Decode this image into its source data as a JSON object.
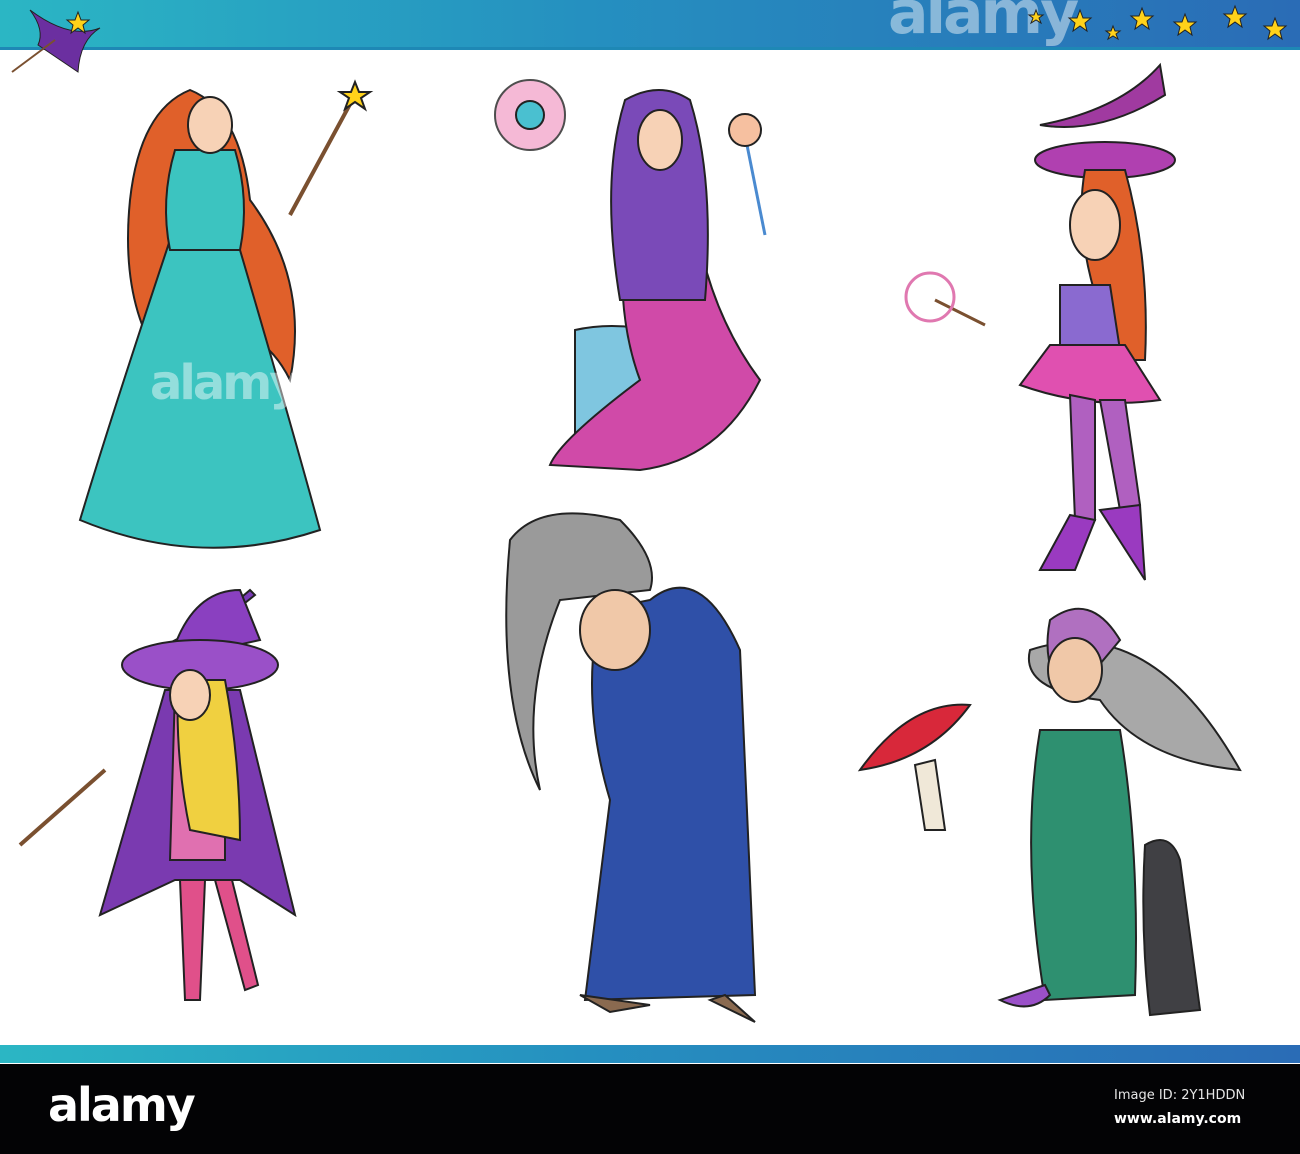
{
  "watermark": {
    "text": "alamy"
  },
  "footer": {
    "logo": "alamy",
    "image_id": "Image ID: 2Y1HDDN",
    "website": "www.alamy.com"
  },
  "illustration": {
    "characters": [
      "fairy-princess",
      "sorceress-on-stump",
      "young-witch-pink-skirt",
      "blonde-witch",
      "old-hag-blue-robe",
      "old-witch-mushroom-cat"
    ]
  },
  "colors": {
    "banner_start": "#2bb6c4",
    "banner_end": "#2a6cb6",
    "footer": "#030305"
  }
}
